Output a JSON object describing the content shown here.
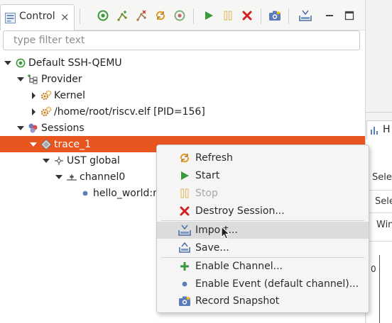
{
  "view": {
    "tab_label": "Control",
    "close_glyph": "×",
    "filter_placeholder": "type filter text"
  },
  "tree": {
    "target": "Default SSH-QEMU",
    "provider": "Provider",
    "kernel": "Kernel",
    "process": "/home/root/riscv.elf [PID=156]",
    "sessions": "Sessions",
    "trace": "trace_1",
    "domain": "UST global",
    "channel": "channel0",
    "event": "hello_world:m"
  },
  "menu": {
    "refresh": "Refresh",
    "start": "Start",
    "stop": "Stop",
    "destroy": "Destroy Session...",
    "import": "Import...",
    "save": "Save...",
    "enable_channel": "Enable Channel...",
    "enable_event": "Enable Event (default channel)...",
    "record_snapshot": "Record Snapshot"
  },
  "right_panel": {
    "tab_partial": "H",
    "row1": "Sele",
    "row2": "Sele",
    "row3": "Win",
    "value": "0"
  },
  "colors": {
    "selection": "#e8561f",
    "green": "#3a9a3a",
    "red": "#d42020",
    "orange": "#e09a20"
  }
}
